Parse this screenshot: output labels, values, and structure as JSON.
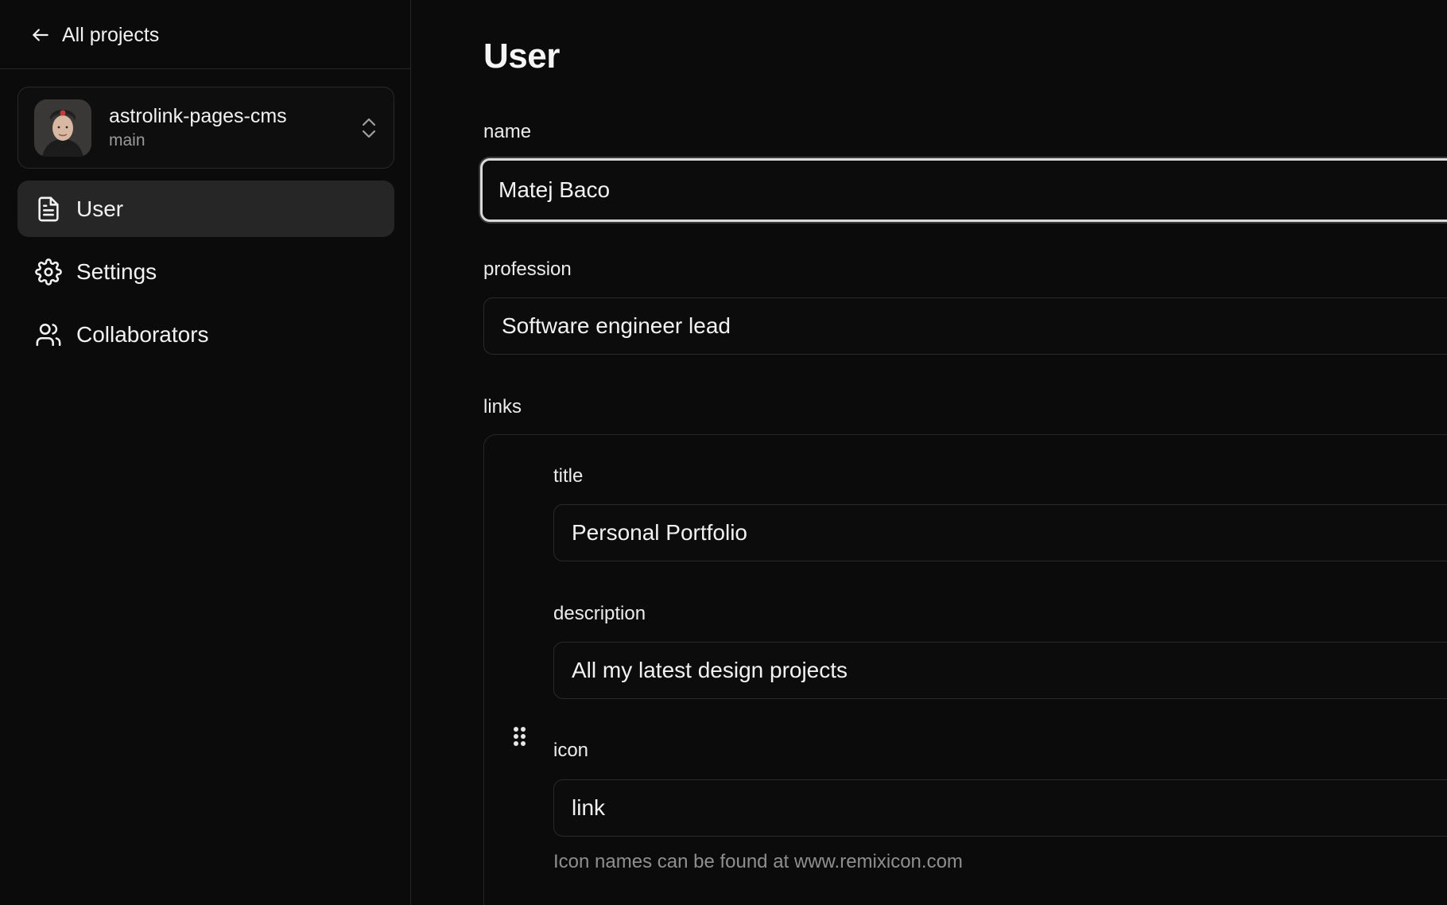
{
  "sidebar": {
    "back_label": "All projects",
    "project": {
      "name": "astrolink-pages-cms",
      "branch": "main"
    },
    "items": [
      {
        "label": "User",
        "icon": "file-text-icon",
        "active": true
      },
      {
        "label": "Settings",
        "icon": "gear-icon",
        "active": false
      },
      {
        "label": "Collaborators",
        "icon": "users-icon",
        "active": false
      }
    ]
  },
  "main": {
    "title": "User",
    "fields": {
      "name": {
        "label": "name",
        "value": "Matej Baco"
      },
      "profession": {
        "label": "profession",
        "value": "Software engineer lead"
      },
      "links": {
        "label": "links"
      }
    },
    "link_item": {
      "title": {
        "label": "title",
        "value": "Personal Portfolio"
      },
      "description": {
        "label": "description",
        "value": "All my latest design projects"
      },
      "icon": {
        "label": "icon",
        "value": "link",
        "help": "Icon names can be found at www.remixicon.com"
      }
    }
  },
  "colors": {
    "background": "#0b0b0b",
    "border": "#262626",
    "active_nav": "#262626",
    "text": "#f2f2f2",
    "muted_text": "#8f8f8f"
  }
}
